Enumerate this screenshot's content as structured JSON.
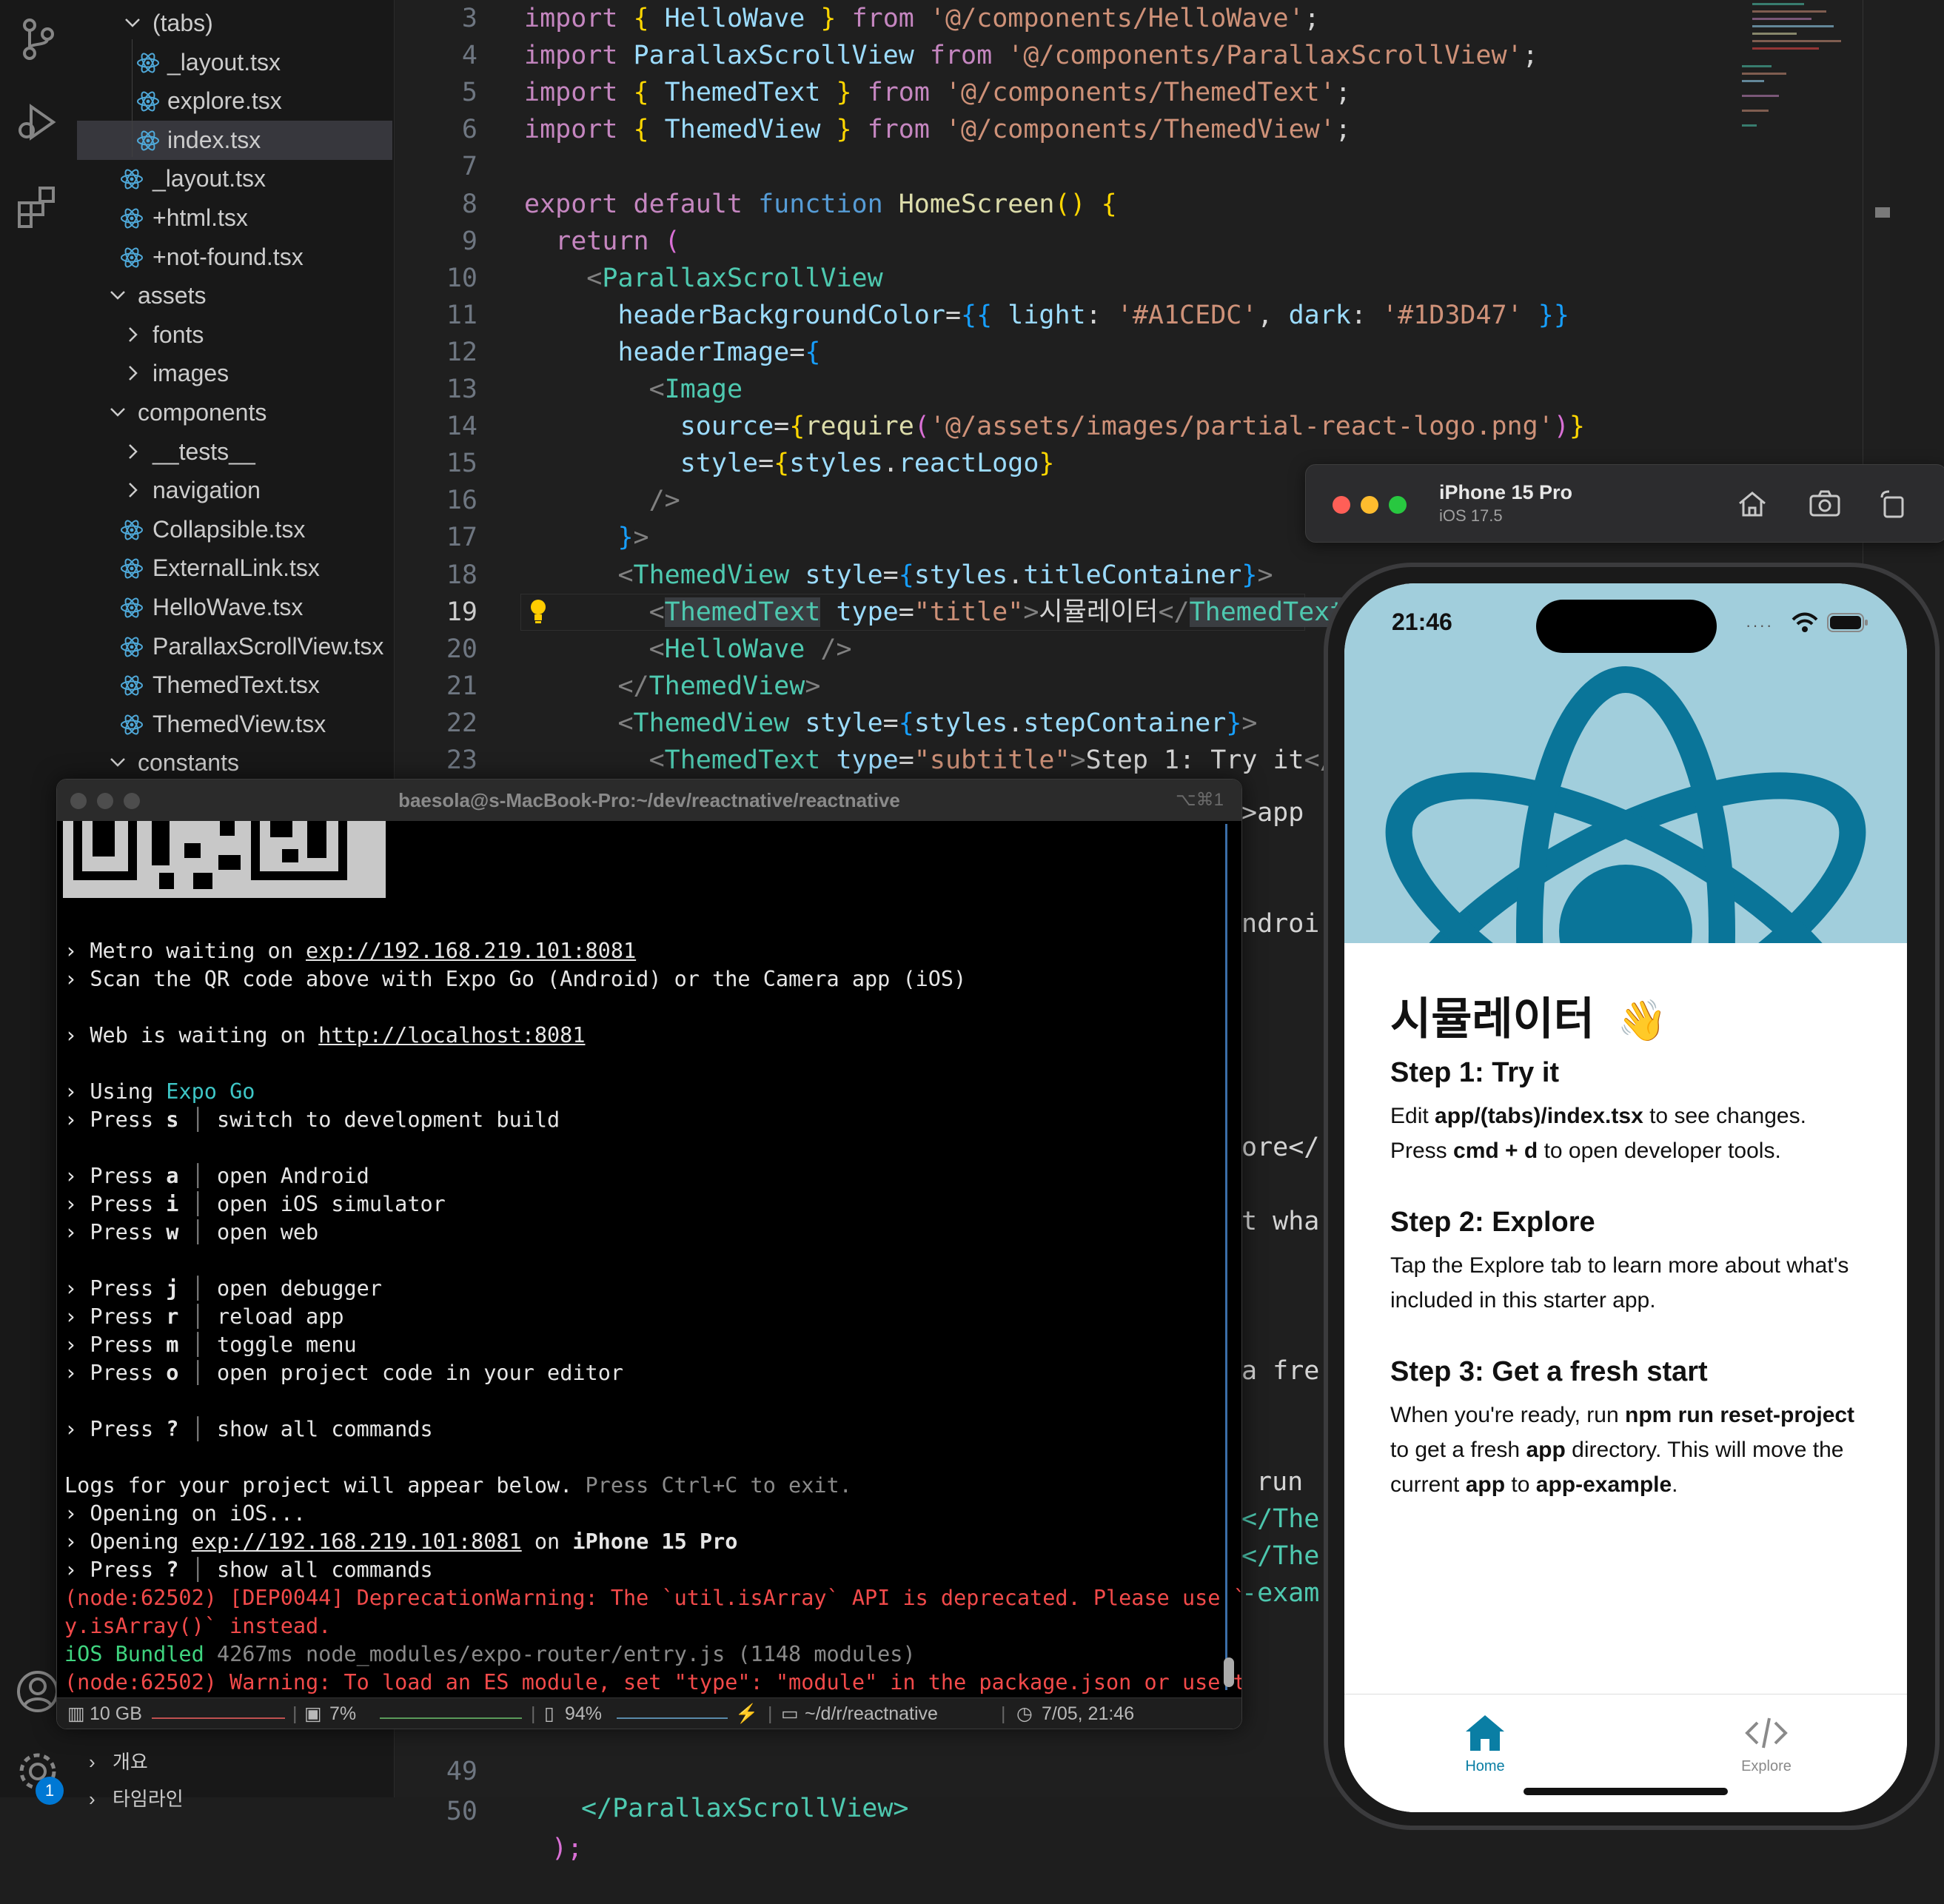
{
  "explorer": {
    "items": [
      {
        "label": "(tabs)",
        "kind": "folder-open"
      },
      {
        "label": "_layout.tsx",
        "kind": "file"
      },
      {
        "label": "explore.tsx",
        "kind": "file"
      },
      {
        "label": "index.tsx",
        "kind": "file",
        "selected": true
      },
      {
        "label": "_layout.tsx",
        "kind": "file"
      },
      {
        "label": "+html.tsx",
        "kind": "file"
      },
      {
        "label": "+not-found.tsx",
        "kind": "file"
      },
      {
        "label": "assets",
        "kind": "folder-open"
      },
      {
        "label": "fonts",
        "kind": "folder-closed"
      },
      {
        "label": "images",
        "kind": "folder-closed"
      },
      {
        "label": "components",
        "kind": "folder-open"
      },
      {
        "label": "__tests__",
        "kind": "folder-closed"
      },
      {
        "label": "navigation",
        "kind": "folder-closed"
      },
      {
        "label": "Collapsible.tsx",
        "kind": "file"
      },
      {
        "label": "ExternalLink.tsx",
        "kind": "file"
      },
      {
        "label": "HelloWave.tsx",
        "kind": "file"
      },
      {
        "label": "ParallaxScrollView.tsx",
        "kind": "file"
      },
      {
        "label": "ThemedText.tsx",
        "kind": "file"
      },
      {
        "label": "ThemedView.tsx",
        "kind": "file"
      },
      {
        "label": "constants",
        "kind": "folder-open"
      }
    ],
    "sections": [
      "개요",
      "타임라인"
    ]
  },
  "editor": {
    "line_numbers": [
      "3",
      "4",
      "5",
      "6",
      "7",
      "8",
      "9",
      "10",
      "11",
      "12",
      "13",
      "14",
      "15",
      "16",
      "17",
      "18",
      "19",
      "20",
      "21",
      "22",
      "23"
    ],
    "active_line": "19",
    "bottom_line_numbers": [
      "49",
      "50"
    ],
    "stray_right": [
      ">app",
      "ndroi",
      "ore</",
      "t wha",
      "a fre",
      "run",
      "</The",
      "</The",
      "-exam"
    ],
    "bottom_code": [
      "</ParallaxScrollView>",
      ");"
    ]
  },
  "terminal": {
    "title": "baesola@s-MacBook-Pro:~/dev/reactnative/reactnative",
    "shortcut": "⌥⌘1",
    "metro_url": "exp://192.168.219.101:8081",
    "web_url": "http://localhost:8081",
    "status": {
      "memory": "10 GB",
      "cpu": "7%",
      "battery": "94%",
      "path": "~/d/r/reactnative",
      "datetime": "7/05, 21:46"
    }
  },
  "simulator": {
    "device": "iPhone 15 Pro",
    "os": "iOS 17.5"
  },
  "app": {
    "time": "21:46",
    "title": "시뮬레이터",
    "wave": "👋",
    "step1_title": "Step 1: Try it",
    "step1_body": [
      "Edit ",
      "app/(tabs)/index.tsx",
      " to see changes. Press ",
      "cmd + d",
      " to open developer tools."
    ],
    "step2_title": "Step 2: Explore",
    "step2_body": "Tap the Explore tab to learn more about what's included in this starter app.",
    "step3_title": "Step 3: Get a fresh start",
    "step3_body": [
      "When you're ready, run ",
      "npm run reset-project",
      " to get a fresh ",
      "app",
      " directory. This will move the current ",
      "app",
      " to ",
      "app-example",
      "."
    ],
    "tabs": [
      {
        "label": "Home",
        "icon": "home-icon",
        "active": true
      },
      {
        "label": "Explore",
        "icon": "code-icon",
        "active": false
      }
    ],
    "colors": {
      "header_light": "#A1CEDC",
      "accent": "#0a7ea4",
      "react_logo": "#0a7599"
    }
  }
}
